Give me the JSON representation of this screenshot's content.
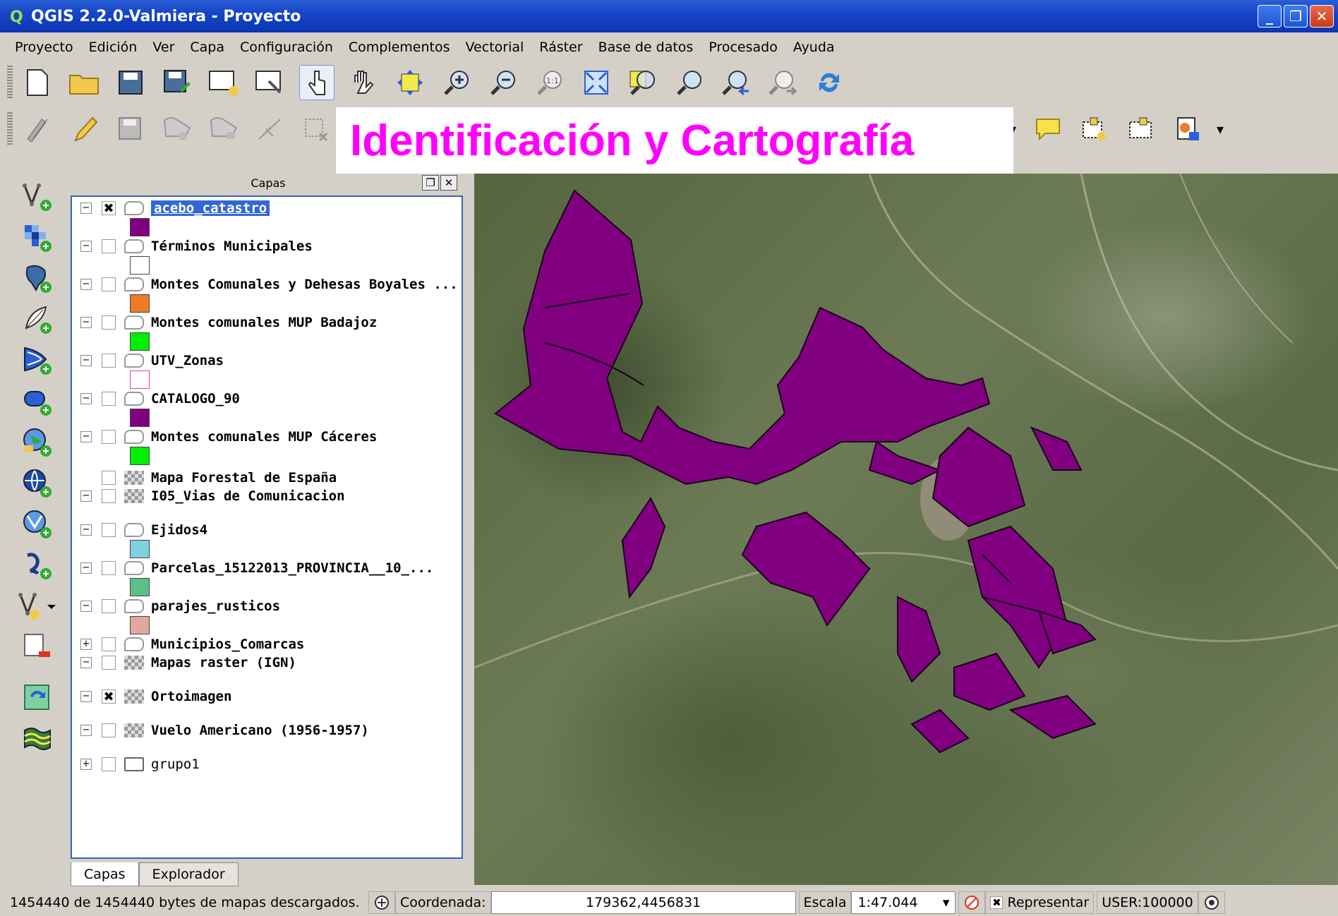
{
  "window": {
    "title": "QGIS 2.2.0-Valmiera - Proyecto"
  },
  "menu": [
    "Proyecto",
    "Edición",
    "Ver",
    "Capa",
    "Configuración",
    "Complementos",
    "Vectorial",
    "Ráster",
    "Base de datos",
    "Procesado",
    "Ayuda"
  ],
  "banner": {
    "text": "Identificación y Cartografía",
    "color": "#ff00ff"
  },
  "layers_panel": {
    "title": "Capas",
    "tabs": [
      "Capas",
      "Explorador"
    ],
    "layers": [
      {
        "name": "acebo_catastro",
        "checked": true,
        "selected": true,
        "swatch": "#800080",
        "type": "vector"
      },
      {
        "name": "Términos Municipales",
        "checked": false,
        "swatch": "#ffffff",
        "type": "vector"
      },
      {
        "name": "Montes Comunales y Dehesas Boyales ...",
        "checked": false,
        "swatch": "#f07a28",
        "type": "vector"
      },
      {
        "name": "Montes comunales MUP Badajoz",
        "checked": false,
        "swatch": "#00ee00",
        "type": "vector"
      },
      {
        "name": "UTV_Zonas",
        "checked": false,
        "swatch": "#ffffff",
        "swatch_border": "#e0409a",
        "type": "vector"
      },
      {
        "name": "CATALOGO_90",
        "checked": false,
        "swatch": "#800080",
        "type": "vector"
      },
      {
        "name": "Montes comunales MUP Cáceres",
        "checked": false,
        "swatch": "#00ee00",
        "type": "vector"
      },
      {
        "name": "Mapa Forestal de España",
        "checked": false,
        "type": "raster"
      },
      {
        "name": "I05_Vias de Comunicacion",
        "checked": false,
        "type": "raster"
      },
      {
        "name": "Ejidos4",
        "checked": false,
        "swatch": "#7fd0e0",
        "type": "vector"
      },
      {
        "name": "Parcelas_15122013_PROVINCIA__10_...",
        "checked": false,
        "swatch": "#5cc08a",
        "type": "vector"
      },
      {
        "name": "parajes_rusticos",
        "checked": false,
        "swatch": "#e0a8a0",
        "type": "vector"
      },
      {
        "name": "Municipios_Comarcas",
        "checked": false,
        "type": "vector"
      },
      {
        "name": "Mapas raster (IGN)",
        "checked": false,
        "type": "raster"
      },
      {
        "name": "Ortoimagen",
        "checked": true,
        "type": "raster"
      },
      {
        "name": "Vuelo Americano (1956-1957)",
        "checked": false,
        "type": "raster"
      },
      {
        "name": "grupo1",
        "checked": false,
        "type": "group"
      }
    ]
  },
  "statusbar": {
    "message": "1454440 de 1454440 bytes de mapas descargados.",
    "coord_label": "Coordenada:",
    "coord_value": "179362,4456831",
    "scale_label": "Escala",
    "scale_value": "1:47.044",
    "render_label": "Representar",
    "crs_label": "USER:100000"
  },
  "icons": {
    "toolbar1": [
      "new-project-icon",
      "open-project-icon",
      "save-project-icon",
      "save-as-icon",
      "new-print-composer-icon",
      "composer-manager-icon",
      "touch-zoom-icon",
      "pan-icon",
      "pan-to-selection-icon",
      "zoom-in-icon",
      "zoom-out-icon",
      "zoom-actual-icon",
      "zoom-full-icon",
      "zoom-selection-icon",
      "zoom-layer-icon",
      "zoom-last-icon",
      "zoom-next-icon",
      "refresh-icon"
    ],
    "toolbar2": [
      "current-edits-icon",
      "toggle-editing-icon",
      "save-edits-icon",
      "add-feature-icon",
      "move-feature-icon",
      "node-tool-icon",
      "delete-selected-icon"
    ],
    "toolbar2_right": [
      "annotation-icon",
      "new-bookmark-icon",
      "show-bookmarks-icon",
      "plugin-icon"
    ],
    "vtoolbar": [
      "add-vector-layer-icon",
      "add-raster-layer-icon",
      "add-postgis-layer-icon",
      "add-spatialite-layer-icon",
      "add-mssql-layer-icon",
      "add-oracle-layer-icon",
      "add-wms-layer-icon",
      "add-wcs-layer-icon",
      "add-wfs-layer-icon",
      "add-delimited-text-icon",
      "new-shapefile-icon",
      "remove-layer-icon",
      "update-icon",
      "terrain-icon"
    ]
  }
}
